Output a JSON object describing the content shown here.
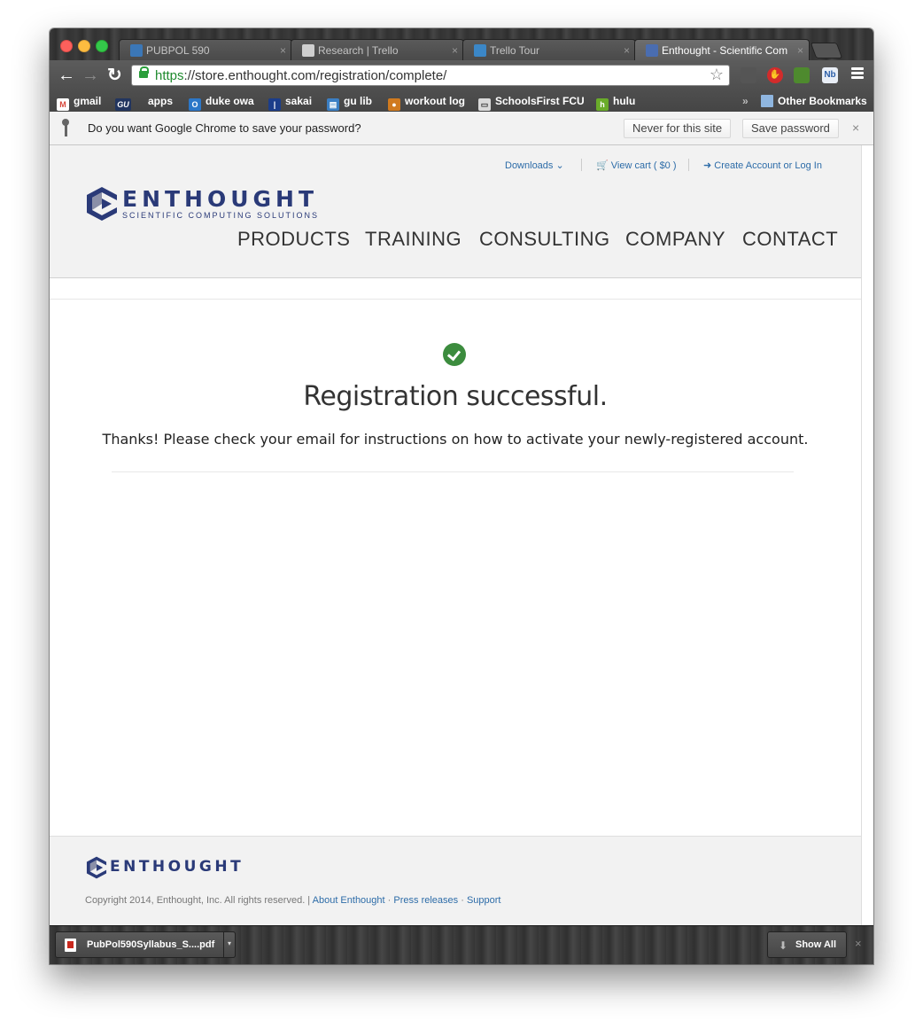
{
  "browser": {
    "tabs": [
      {
        "title": "PUBPOL 590",
        "favicon_color": "#3b77b7"
      },
      {
        "title": "Research | Trello",
        "favicon_color": "#cfcfcf"
      },
      {
        "title": "Trello Tour",
        "favicon_color": "#3b87c7"
      },
      {
        "title": "Enthought - Scientific Com",
        "favicon_color": "#4a6db0"
      }
    ],
    "tab_close_glyph": "×",
    "url_protocol": "https",
    "url_rest": "://store.enthought.com/registration/complete/",
    "bookmarks": [
      {
        "label": "gmail",
        "icon": "gmail-icon",
        "color": "#d7463a",
        "glyph": "M"
      },
      {
        "label": "apps",
        "icon": "gu-icon",
        "color": "#22355f",
        "glyph": "GU"
      },
      {
        "label": "duke owa",
        "icon": "outlook-icon",
        "color": "#2c77c8",
        "glyph": "O"
      },
      {
        "label": "sakai",
        "icon": "sakai-icon",
        "color": "#1b3d8a",
        "glyph": "|"
      },
      {
        "label": "gu lib",
        "icon": "library-icon",
        "color": "#3b7fc4",
        "glyph": "▤"
      },
      {
        "label": "workout log",
        "icon": "workout-icon",
        "color": "#d07a1f",
        "glyph": "●"
      },
      {
        "label": "SchoolsFirst FCU",
        "icon": "bank-icon",
        "color": "#d9d9d9",
        "glyph": "▭"
      },
      {
        "label": "hulu",
        "icon": "hulu-icon",
        "color": "#6aac2a",
        "glyph": "h"
      }
    ],
    "overflow_glyph": "»",
    "other_bookmarks": "Other Bookmarks"
  },
  "infobar": {
    "question": "Do you want Google Chrome to save your password?",
    "never_label": "Never for this site",
    "save_label": "Save password",
    "close_glyph": "×"
  },
  "site": {
    "util": {
      "downloads": "Downloads ⌄",
      "cart": "🛒 View cart ( $0 )",
      "account": "➜ Create Account or Log In"
    },
    "logo_word": "ENTHOUGHT",
    "logo_tagline": "SCIENTIFIC COMPUTING SOLUTIONS",
    "nav": [
      "PRODUCTS",
      "TRAINING",
      "CONSULTING",
      "COMPANY",
      "CONTACT"
    ],
    "heading": "Registration successful.",
    "message": "Thanks! Please check your email for instructions on how to activate your newly-registered account.",
    "footer": {
      "logo_word": "ENTHOUGHT",
      "copyright": "Copyright 2014, Enthought, Inc. All rights reserved. |",
      "links": [
        "About Enthought",
        "Press releases",
        "Support"
      ],
      "separator": "·"
    },
    "colors": {
      "brand_navy": "#2a3a78",
      "link_blue": "#2d6ca8",
      "success_green": "#3c8c3e"
    }
  },
  "download_shelf": {
    "file_name": "PubPol590Syllabus_S....pdf",
    "show_all": "Show All",
    "menu_glyph": "▾",
    "close_glyph": "×"
  }
}
